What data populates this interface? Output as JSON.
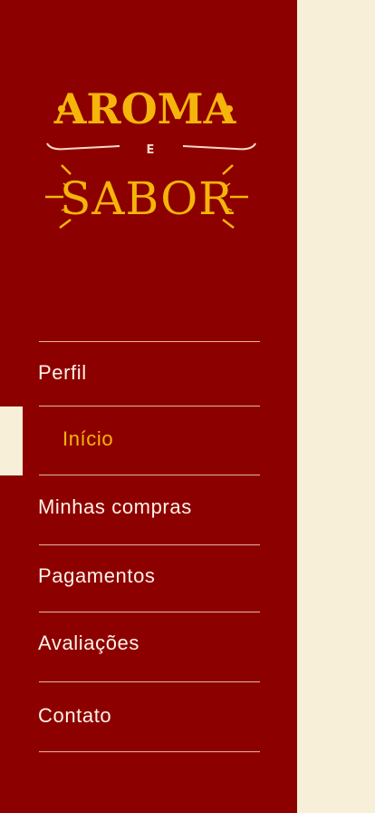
{
  "brand": {
    "line1": "AROMA",
    "line2": "E",
    "line3": "SABOR"
  },
  "colors": {
    "drawer_bg": "#8d0000",
    "content_bg": "#f8efd8",
    "accent": "#f5b50a",
    "text": "#fff2e8"
  },
  "menu": {
    "items": [
      {
        "label": "Perfil",
        "active": false
      },
      {
        "label": "Início",
        "active": true
      },
      {
        "label": "Minhas compras",
        "active": false
      },
      {
        "label": "Pagamentos",
        "active": false
      },
      {
        "label": "Avaliações",
        "active": false
      },
      {
        "label": "Contato",
        "active": false
      }
    ]
  }
}
